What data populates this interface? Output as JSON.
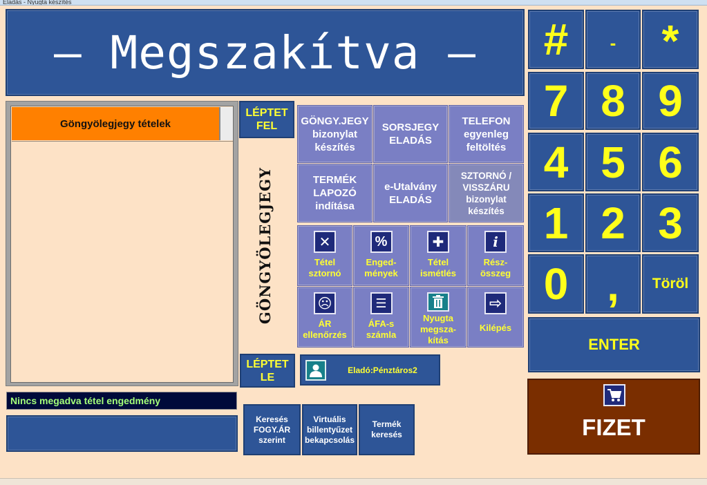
{
  "window": {
    "title": "Eladás - Nyugta készítés"
  },
  "banner": {
    "text": "— Megszakítva —"
  },
  "list": {
    "header": "Göngyölegjegy tételek"
  },
  "message": {
    "text": "Nincs megadva tétel engedmény"
  },
  "nav": {
    "up": "LÉPTET FEL",
    "down": "LÉPTET LE"
  },
  "mode_label": "GÖNGYÖLEGJEGY",
  "functions": [
    {
      "name": "gongy-jegy",
      "label": "GÖNGY.JEGY bizonylat készítés"
    },
    {
      "name": "sorsjegy",
      "label": "SORSJEGY ELADÁS"
    },
    {
      "name": "telefon",
      "label": "TELEFON egyenleg feltöltés"
    },
    {
      "name": "termek-lapozo",
      "label": "TERMÉK LAPOZÓ indítása"
    },
    {
      "name": "e-utalvany",
      "label": "e-Utalvány ELADÁS"
    },
    {
      "name": "sztorno",
      "label": "SZTORNÓ / VISSZÁRU bizonylat készítés"
    }
  ],
  "actions": [
    {
      "icon": "close-icon",
      "label": "Tétel sztornó"
    },
    {
      "icon": "percent-icon",
      "label": "Enged-mények"
    },
    {
      "icon": "plus-icon",
      "label": "Tétel ismétlés"
    },
    {
      "icon": "info-icon",
      "label": "Rész-összeg"
    },
    {
      "icon": "face-icon",
      "label": "ÁR ellenőrzés"
    },
    {
      "icon": "invoice-icon",
      "label": "ÁFA-s számla"
    },
    {
      "icon": "trash-icon",
      "label": "Nyugta megsza-kítás"
    },
    {
      "icon": "exit-icon",
      "label": "Kilépés"
    }
  ],
  "seller": {
    "label": "Eladó:Pénztáros2"
  },
  "bottom_buttons": [
    {
      "label": "Keresés FOGY.ÁR szerint"
    },
    {
      "label": "Virtuális billentyűzet bekapcsolás"
    },
    {
      "label": "Termék keresés"
    }
  ],
  "keypad": {
    "keys": [
      "#",
      "-",
      "*",
      "7",
      "8",
      "9",
      "4",
      "5",
      "6",
      "1",
      "2",
      "3",
      "0",
      ",",
      "Töröl"
    ],
    "enter": "ENTER"
  },
  "pay": {
    "label": "FIZET",
    "icon": "cart-icon"
  },
  "colors": {
    "background": "#fde2c6",
    "panel_blue": "#2e5597",
    "function_purple": "#7a7fc4",
    "accent_yellow": "#ffff1a",
    "header_orange": "#ff8000",
    "pay_brown": "#7a2e00"
  }
}
